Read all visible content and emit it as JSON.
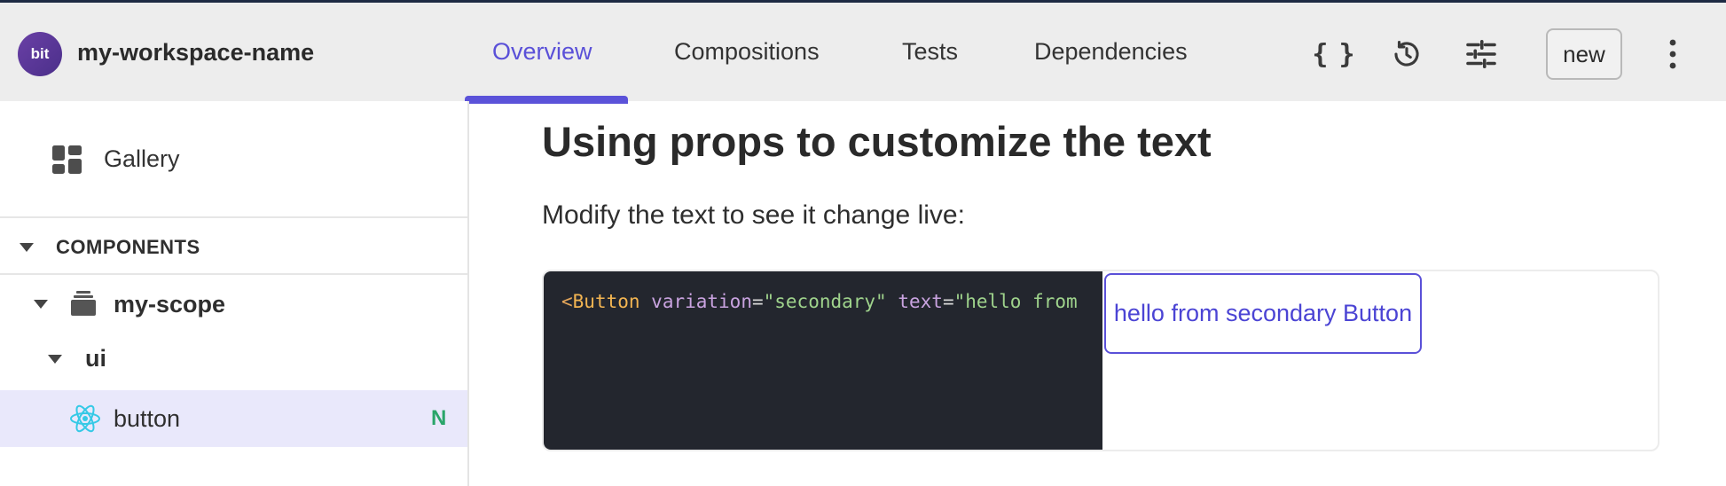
{
  "header": {
    "logo_text": "bit",
    "workspace_name": "my-workspace-name",
    "tabs": [
      {
        "label": "Overview",
        "active": true
      },
      {
        "label": "Compositions",
        "active": false
      },
      {
        "label": "Tests",
        "active": false
      },
      {
        "label": "Dependencies",
        "active": false
      }
    ],
    "icons": [
      "code-braces-icon",
      "history-icon",
      "settings-sliders-icon",
      "more-vertical-icon"
    ],
    "new_label": "new",
    "accent_color": "#5b52d9"
  },
  "sidebar": {
    "gallery_label": "Gallery",
    "components_label": "COMPONENTS",
    "scope_label": "my-scope",
    "namespace_label": "ui",
    "component": {
      "label": "button",
      "badge": "N",
      "badge_color": "#2aa56a",
      "icon": "react-icon"
    }
  },
  "main": {
    "heading": "Using props to customize the text",
    "description": "Modify the text to see it change live:",
    "code": {
      "open": "<",
      "tag": "Button",
      "attr1": "variation",
      "eq1": "=",
      "val1": "\"secondary\"",
      "attr2": "text",
      "eq2": "=",
      "val2": "\"hello from"
    },
    "preview_button_label": "hello from secondary Button"
  }
}
